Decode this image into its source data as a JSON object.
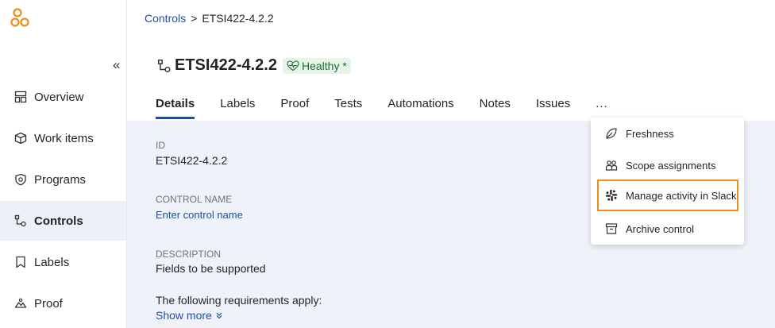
{
  "sidebar": {
    "collapse_glyph": "«",
    "items": [
      {
        "label": "Overview",
        "icon": "overview-icon"
      },
      {
        "label": "Work items",
        "icon": "box-icon"
      },
      {
        "label": "Programs",
        "icon": "shield-icon"
      },
      {
        "label": "Controls",
        "icon": "controls-icon",
        "active": true
      },
      {
        "label": "Labels",
        "icon": "label-icon"
      },
      {
        "label": "Proof",
        "icon": "proof-icon"
      }
    ]
  },
  "breadcrumb": {
    "parent": "Controls",
    "separator": ">",
    "current": "ETSI422-4.2.2"
  },
  "page": {
    "title": "ETSI422-4.2.2",
    "status": "Healthy *"
  },
  "tabs": [
    "Details",
    "Labels",
    "Proof",
    "Tests",
    "Automations",
    "Notes",
    "Issues",
    "..."
  ],
  "fields": {
    "id_label": "ID",
    "id_value": "ETSI422-4.2.2",
    "name_label": "CONTROL NAME",
    "name_placeholder": "Enter control name",
    "desc_label": "DESCRIPTION",
    "desc_value": "Fields to be supported",
    "desc_value2": "The following requirements apply:",
    "show_more": "Show more"
  },
  "menu": {
    "items": [
      {
        "label": "Freshness",
        "icon": "leaf-icon"
      },
      {
        "label": "Scope assignments",
        "icon": "people-icon"
      },
      {
        "label": "Manage activity in Slack",
        "icon": "slack-icon",
        "highlighted": true
      },
      {
        "label": "Archive control",
        "icon": "archive-icon"
      }
    ]
  },
  "colors": {
    "accent": "#1c4fa5",
    "brand": "#f08c1c",
    "healthy_bg": "#e6f4ea",
    "healthy_text": "#1f6b38"
  }
}
